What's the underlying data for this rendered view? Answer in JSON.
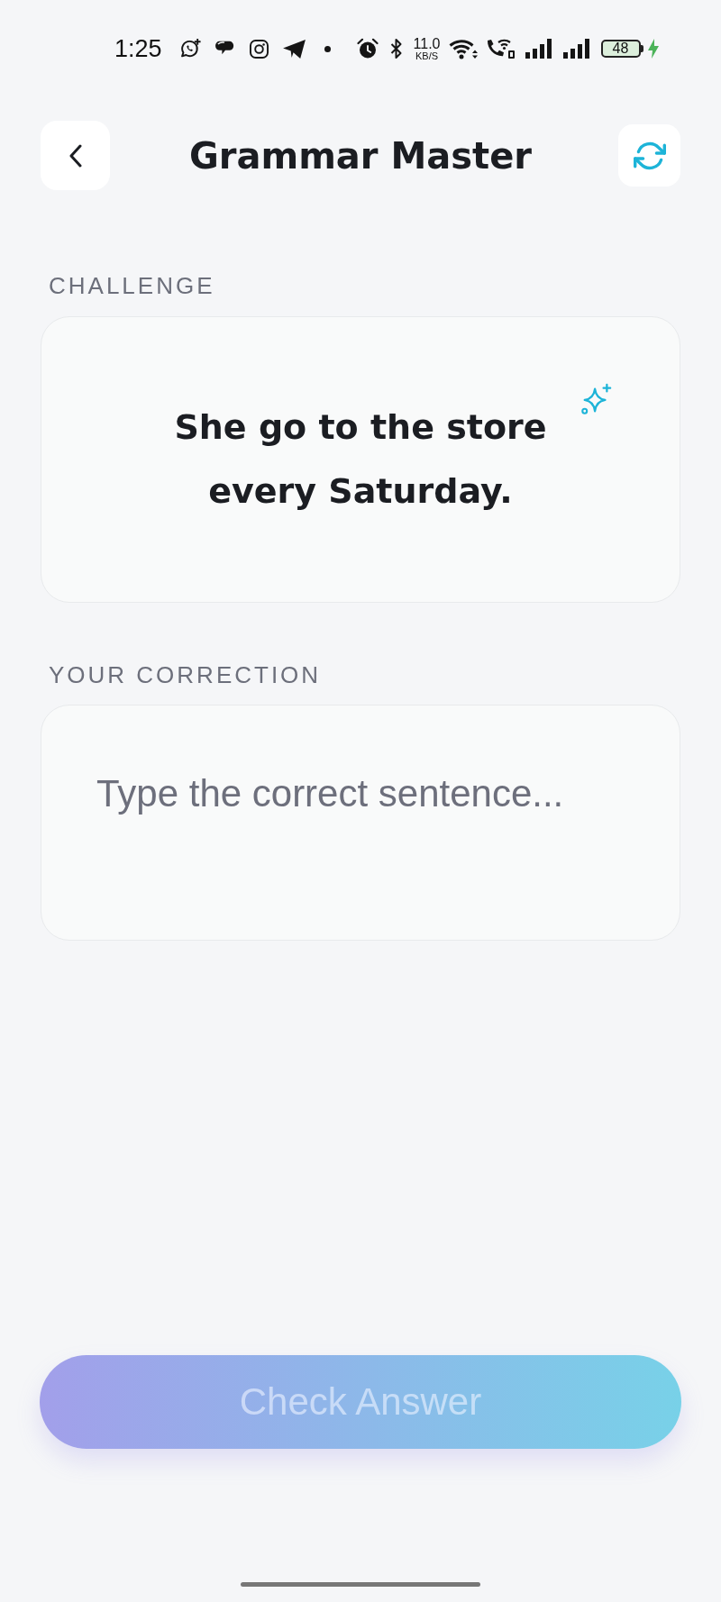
{
  "status_bar": {
    "time": "1:25",
    "net_speed": "11.0",
    "net_speed_unit": "KB/S",
    "battery": "48",
    "charging": true
  },
  "header": {
    "title": "Grammar Master"
  },
  "challenge": {
    "label": "CHALLENGE",
    "sentence": "She go to the store every Saturday."
  },
  "correction": {
    "label": "YOUR CORRECTION",
    "placeholder": "Type the correct sentence..."
  },
  "submit_button": {
    "label": "Check Answer",
    "disabled": true
  }
}
